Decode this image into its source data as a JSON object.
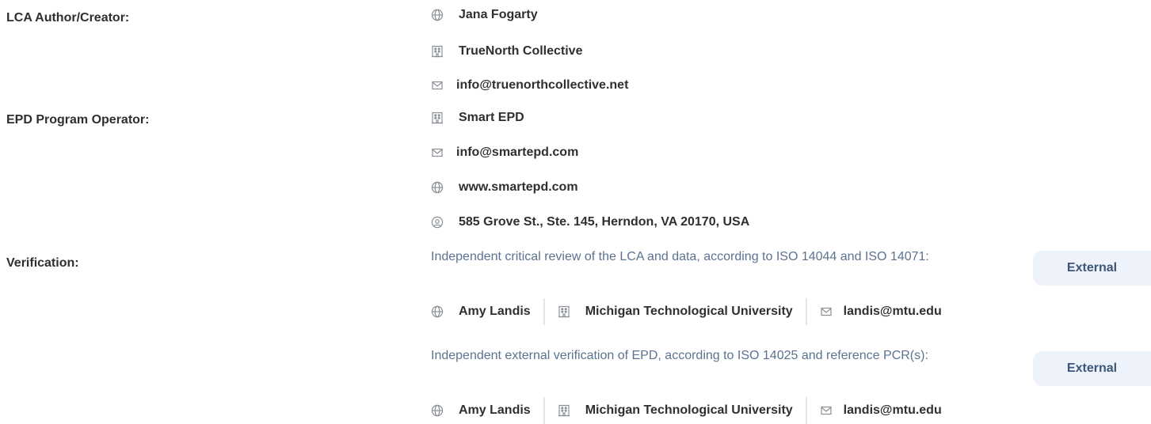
{
  "lca": {
    "label": "LCA Author/Creator:",
    "name": "Jana Fogarty",
    "org": "TrueNorth Collective",
    "email": "info@truenorthcollective.net"
  },
  "epd": {
    "label": "EPD Program Operator:",
    "org": "Smart EPD",
    "email": "info@smartepd.com",
    "website": "www.smartepd.com",
    "address": "585 Grove St., Ste. 145, Herndon, VA 20170, USA"
  },
  "verification": {
    "label": "Verification:",
    "items": [
      {
        "description": "Independent critical review of the LCA and data, according to ISO 14044 and ISO 14071:",
        "badge": "External",
        "person": "Amy Landis",
        "org": "Michigan Technological University",
        "email": "landis@mtu.edu"
      },
      {
        "description": "Independent external verification of EPD, according to ISO 14025 and reference PCR(s):",
        "badge": "External",
        "person": "Amy Landis",
        "org": "Michigan Technological University",
        "email": "landis@mtu.edu"
      }
    ]
  },
  "icons": {
    "person": "globe-icon",
    "org": "building-icon",
    "email": "envelope-icon",
    "address": "location-pin-icon"
  },
  "colors": {
    "description_text": "#5b7391",
    "badge_bg": "#eef3fb",
    "badge_text": "#3b5676",
    "icon": "#8a8f96"
  }
}
